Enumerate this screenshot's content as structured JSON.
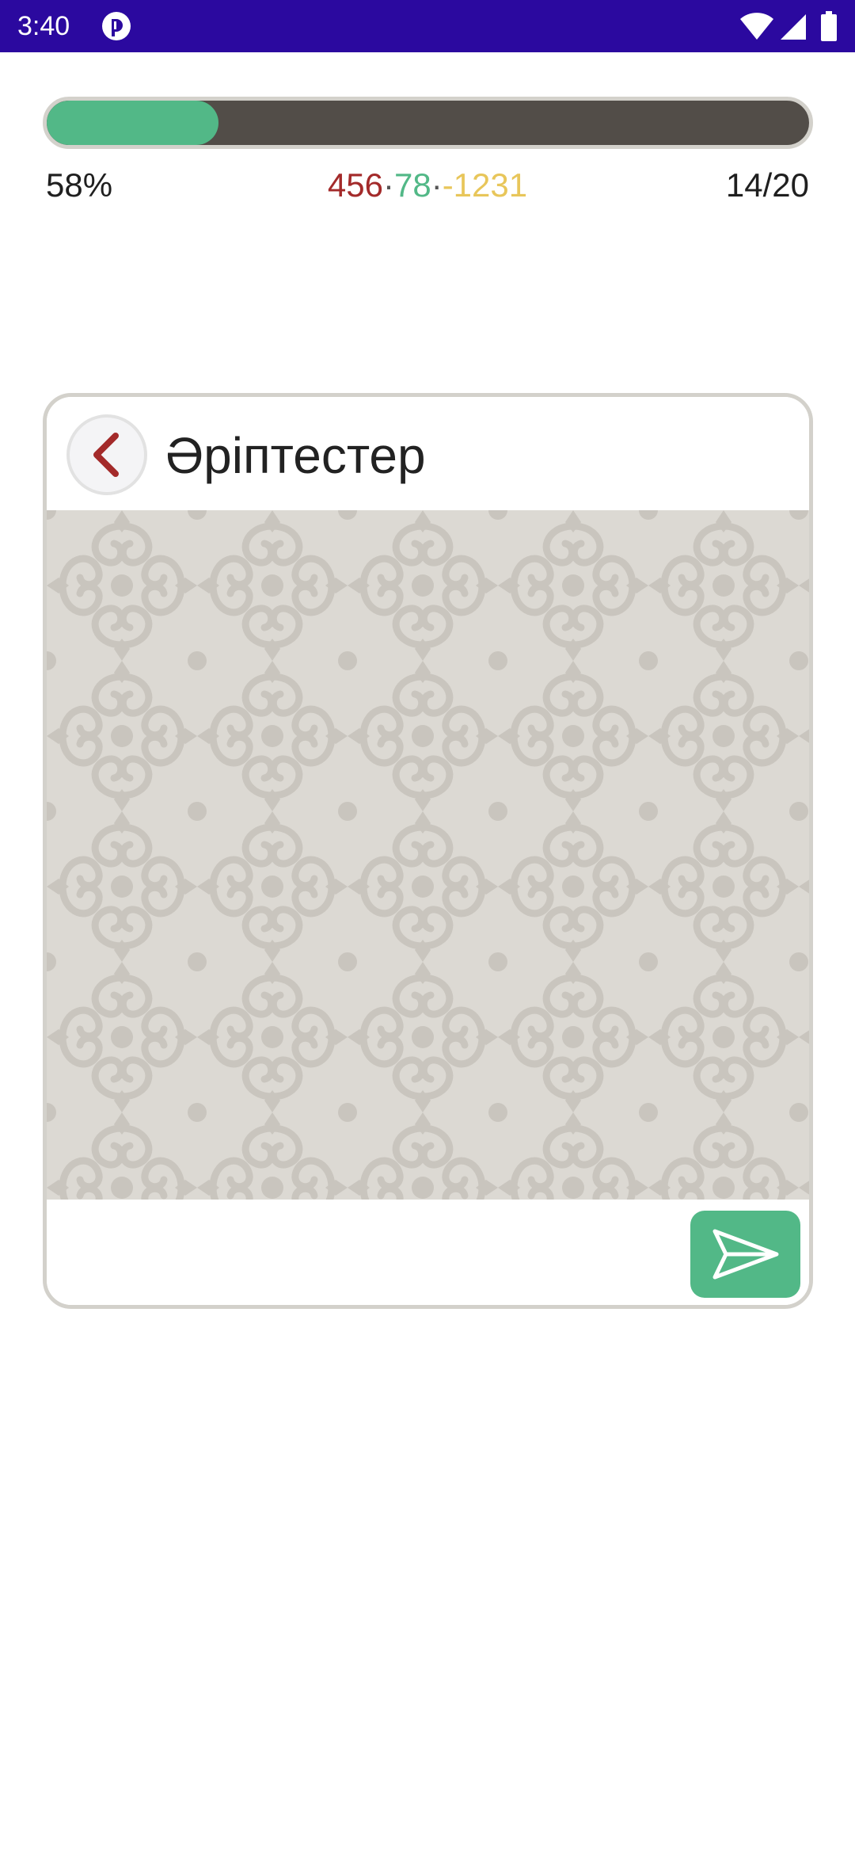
{
  "status_bar": {
    "time": "3:40",
    "background": "#2b099f",
    "icons": [
      "app-notification-icon",
      "wifi-icon",
      "signal-icon",
      "battery-icon"
    ]
  },
  "progress": {
    "fraction": 0.225,
    "percent_label": "58%",
    "fill_color": "#52b887",
    "track_color": "#524d48"
  },
  "score": {
    "red_value": "456",
    "separator1": "·",
    "green_value": "78",
    "separator2": "·",
    "yellow_value": "-1231",
    "colors": {
      "red": "#a32a2a",
      "green": "#52b887",
      "yellow": "#e8c65a"
    }
  },
  "question_count": "14/20",
  "card": {
    "title": "Әріптестер",
    "back_icon": "chevron-left-icon",
    "pattern": "ornamental-pattern",
    "input_value": "",
    "send_icon": "send-icon",
    "accent": "#52b887"
  }
}
